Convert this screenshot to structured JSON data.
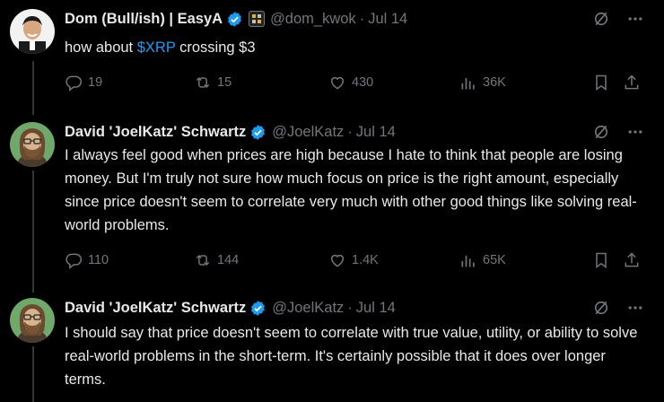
{
  "tweets": [
    {
      "name": "Dom (Bull/ish) | EasyA",
      "handle": "@dom_kwok",
      "separator": "·",
      "time": "Jul 14",
      "text_before": "how about ",
      "cashtag": "$XRP",
      "text_after": " crossing $3",
      "replies": "19",
      "reposts": "15",
      "likes": "430",
      "views": "36K"
    },
    {
      "name": "David 'JoelKatz' Schwartz",
      "handle": "@JoelKatz",
      "separator": "·",
      "time": "Jul 14",
      "text": "I always feel good when prices are high because I hate to think that people are losing money. But I'm truly not sure how much focus on price is the right amount, especially since price doesn't seem to correlate very much with other good things like solving real-world problems.",
      "replies": "110",
      "reposts": "144",
      "likes": "1.4K",
      "views": "65K"
    },
    {
      "name": "David 'JoelKatz' Schwartz",
      "handle": "@JoelKatz",
      "separator": "·",
      "time": "Jul 14",
      "text": "I should say that price doesn't seem to correlate with true value, utility, or ability to solve real-world problems in the short-term. It's certainly possible that it does over longer terms."
    }
  ],
  "icons": {
    "verified": "verified-badge-icon",
    "affiliate": "affiliate-badge-icon",
    "grok": "grok-icon",
    "more": "more-icon",
    "reply": "reply-icon",
    "repost": "repost-icon",
    "like": "like-icon",
    "views": "views-icon",
    "bookmark": "bookmark-icon",
    "share": "share-icon"
  },
  "colors": {
    "background": "#000000",
    "text": "#e7e9ea",
    "secondary": "#71767b",
    "accent": "#1d9bf0",
    "thread_line": "#333639"
  }
}
